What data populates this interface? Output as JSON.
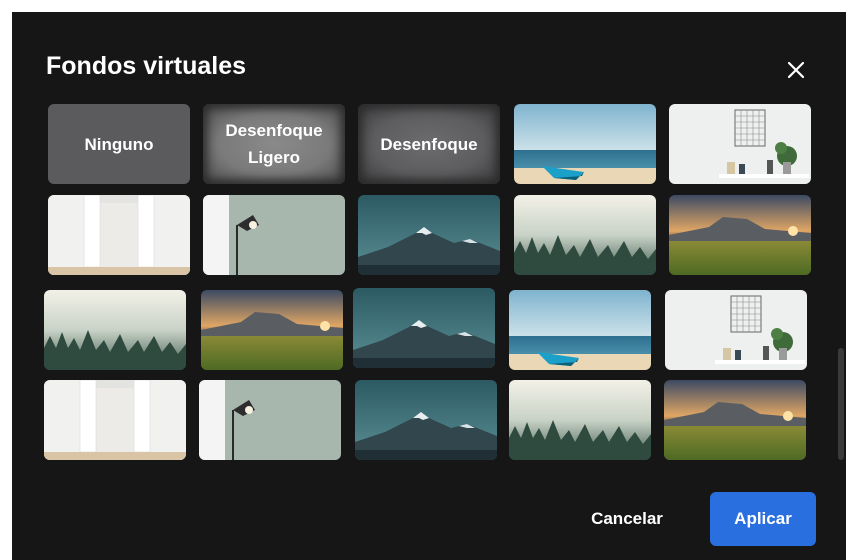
{
  "dialog": {
    "title": "Fondos virtuales",
    "close_icon": "close-icon"
  },
  "options": {
    "none": "Ninguno",
    "blur_light_line1": "Desenfoque",
    "blur_light_line2": "Ligero",
    "blur": "Desenfoque"
  },
  "backgrounds": [
    "beach-boat",
    "shelf-room",
    "white-doors",
    "lamp-wall",
    "mountains",
    "foggy-forest",
    "meadow-sunset"
  ],
  "buttons": {
    "cancel": "Cancelar",
    "apply": "Aplicar"
  },
  "colors": {
    "background": "#161616",
    "apply_button": "#2a6fe0"
  }
}
